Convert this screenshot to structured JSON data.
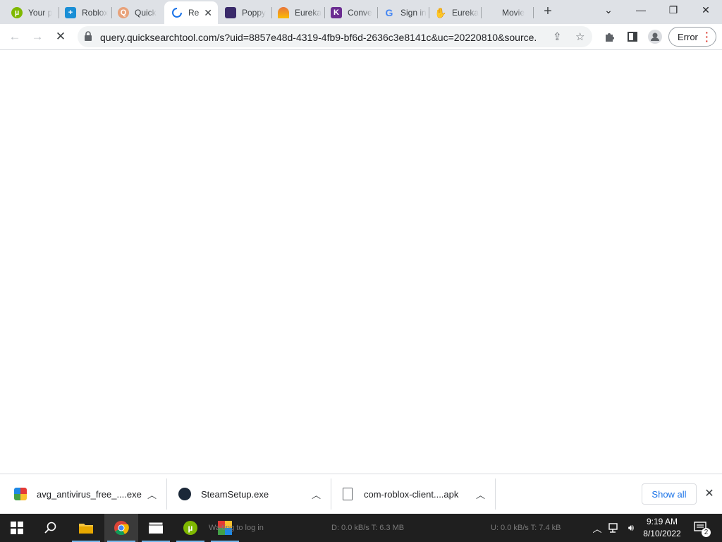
{
  "tabs": [
    {
      "title": "Your p",
      "icon": "utorrent-favicon",
      "color": "#7fb800"
    },
    {
      "title": "Roblox",
      "icon": "plus-favicon",
      "color": "#1a8fd6"
    },
    {
      "title": "Quick",
      "icon": "search-favicon",
      "color": "#e8a27a"
    },
    {
      "title": "Re",
      "icon": "loading-spinner-icon",
      "color": "#1a73e8"
    },
    {
      "title": "Poppy",
      "icon": "poppy-favicon",
      "color": "#3a2a6a"
    },
    {
      "title": "Eureka",
      "icon": "eureka-favicon",
      "color": "#e8743b"
    },
    {
      "title": "Conve",
      "icon": "convert-favicon",
      "color": "#6b2c91"
    },
    {
      "title": "Sign in",
      "icon": "google-favicon",
      "color": "#4285f4"
    },
    {
      "title": "Eureka",
      "icon": "eureka-hand-favicon",
      "color": "#5f6368"
    },
    {
      "title": "Movie",
      "icon": "",
      "color": ""
    }
  ],
  "new_tab_label": "+",
  "address_bar": {
    "url": "query.quicksearchtool.com/s?uid=8857e48d-4319-4fb9-bf6d-2636c3e8141c&uc=20220810&source..."
  },
  "profile_error_label": "Error",
  "downloads": [
    {
      "name": "avg_antivirus_free_....exe",
      "icon": "avg-icon"
    },
    {
      "name": "SteamSetup.exe",
      "icon": "steam-icon"
    },
    {
      "name": "com-roblox-client....apk",
      "icon": "file-icon"
    }
  ],
  "show_all_label": "Show all",
  "taskbar_ghost_texts": {
    "status": "Waiting to log in",
    "download": "D: 0.0 kB/s T: 6.3 MB",
    "upload": "U: 0.0 kB/s T: 7.4 kB"
  },
  "clock": {
    "time": "9:19 AM",
    "date": "8/10/2022"
  },
  "notification_count": "2"
}
